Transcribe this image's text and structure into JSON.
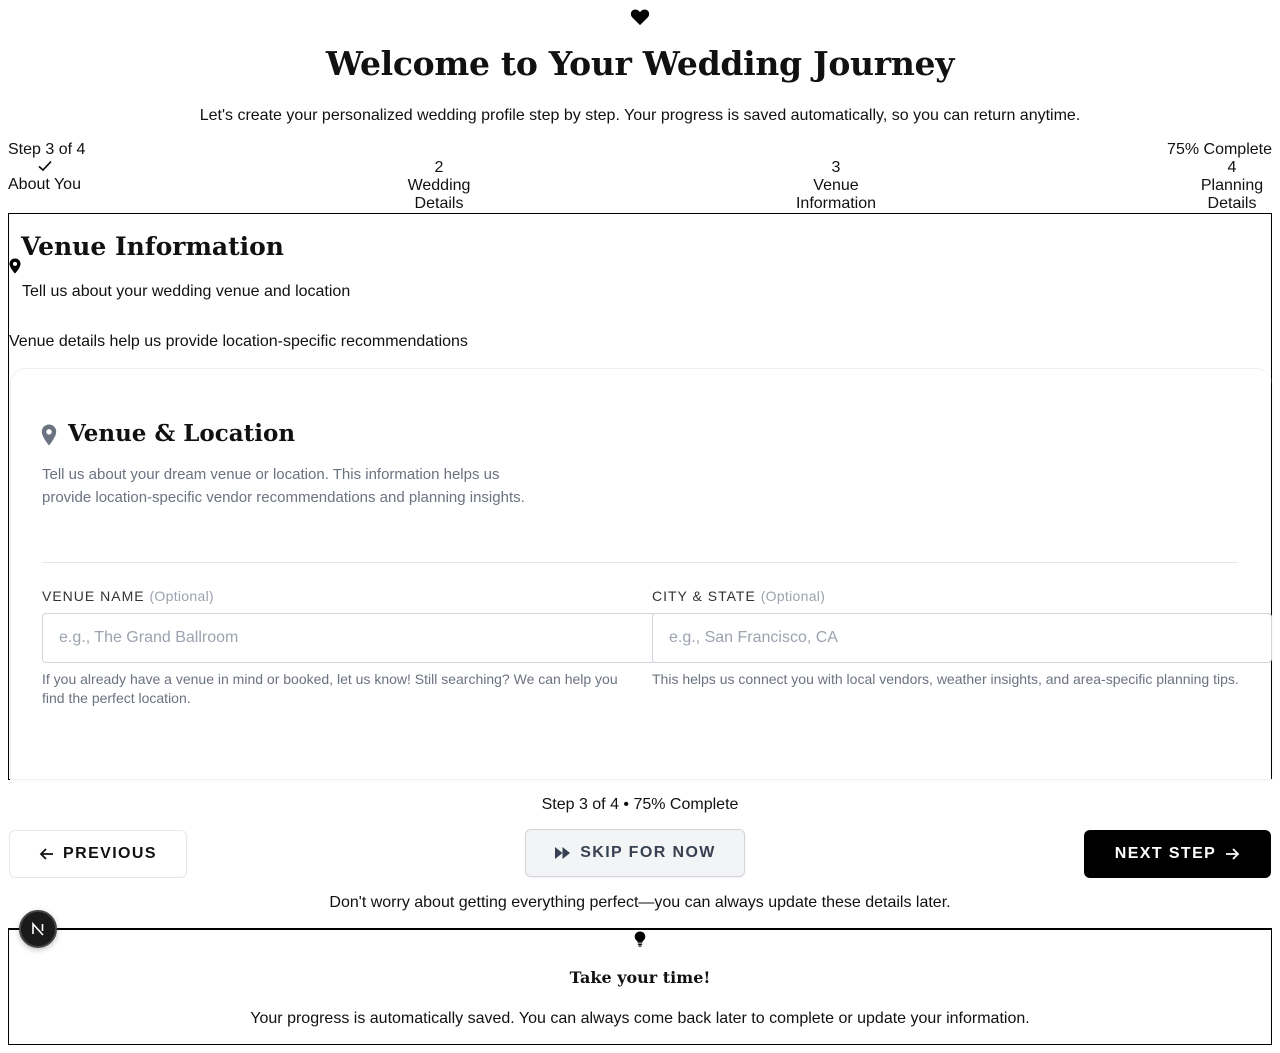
{
  "header": {
    "title": "Welcome to Your Wedding Journey",
    "subtitle": "Let's create your personalized wedding profile step by step. Your progress is saved automatically, so you can return anytime."
  },
  "progress": {
    "step_label": "Step 3 of 4",
    "percent_label": "75% Complete",
    "percent": 75
  },
  "steps": [
    {
      "number": "",
      "label": "About You",
      "status": "completed"
    },
    {
      "number": "2",
      "label": "Wedding Details",
      "status": "pending"
    },
    {
      "number": "3",
      "label": "Venue Information",
      "status": "current"
    },
    {
      "number": "4",
      "label": "Planning Details",
      "status": "pending"
    }
  ],
  "section": {
    "title": "Venue Information",
    "description": "Tell us about your wedding venue and location",
    "hint": "Venue details help us provide location-specific recommendations"
  },
  "card": {
    "title": "Venue & Location",
    "description": "Tell us about your dream venue or location. This information helps us provide location-specific vendor recommendations and planning insights."
  },
  "fields": {
    "venue": {
      "label": "VENUE NAME",
      "optional": "(Optional)",
      "value": "",
      "placeholder": "e.g., The Grand Ballroom",
      "help": "If you already have a venue in mind or booked, let us know! Still searching? We can help you find the perfect location."
    },
    "city": {
      "label": "CITY & STATE",
      "optional": "(Optional)",
      "value": "",
      "placeholder": "e.g., San Francisco, CA",
      "help": "This helps us connect you with local vendors, weather insights, and area-specific planning tips."
    }
  },
  "footer": {
    "progress_text": "Step 3 of 4 • 75% Complete",
    "previous_label": "PREVIOUS",
    "skip_label": "SKIP FOR NOW",
    "next_label": "NEXT STEP",
    "reassurance": "Don't worry about getting everything perfect—you can always update these details later."
  },
  "tip": {
    "title": "Take your time!",
    "text": "Your progress is automatically saved. You can always come back later to complete or update your information."
  },
  "badge": {
    "letter": "N"
  },
  "icons": {
    "heart": "heart-icon",
    "check": "check-icon",
    "pin": "map-pin-icon",
    "arrow_left": "arrow-left-icon",
    "fast_forward": "fast-forward-icon",
    "arrow_right": "arrow-right-icon",
    "bulb": "lightbulb-icon"
  },
  "colors": {
    "primary": "#000000",
    "muted_text": "#6b7280",
    "placeholder": "#9ca3af",
    "border": "#d1d5db",
    "skip_bg": "#f3f4f6"
  }
}
